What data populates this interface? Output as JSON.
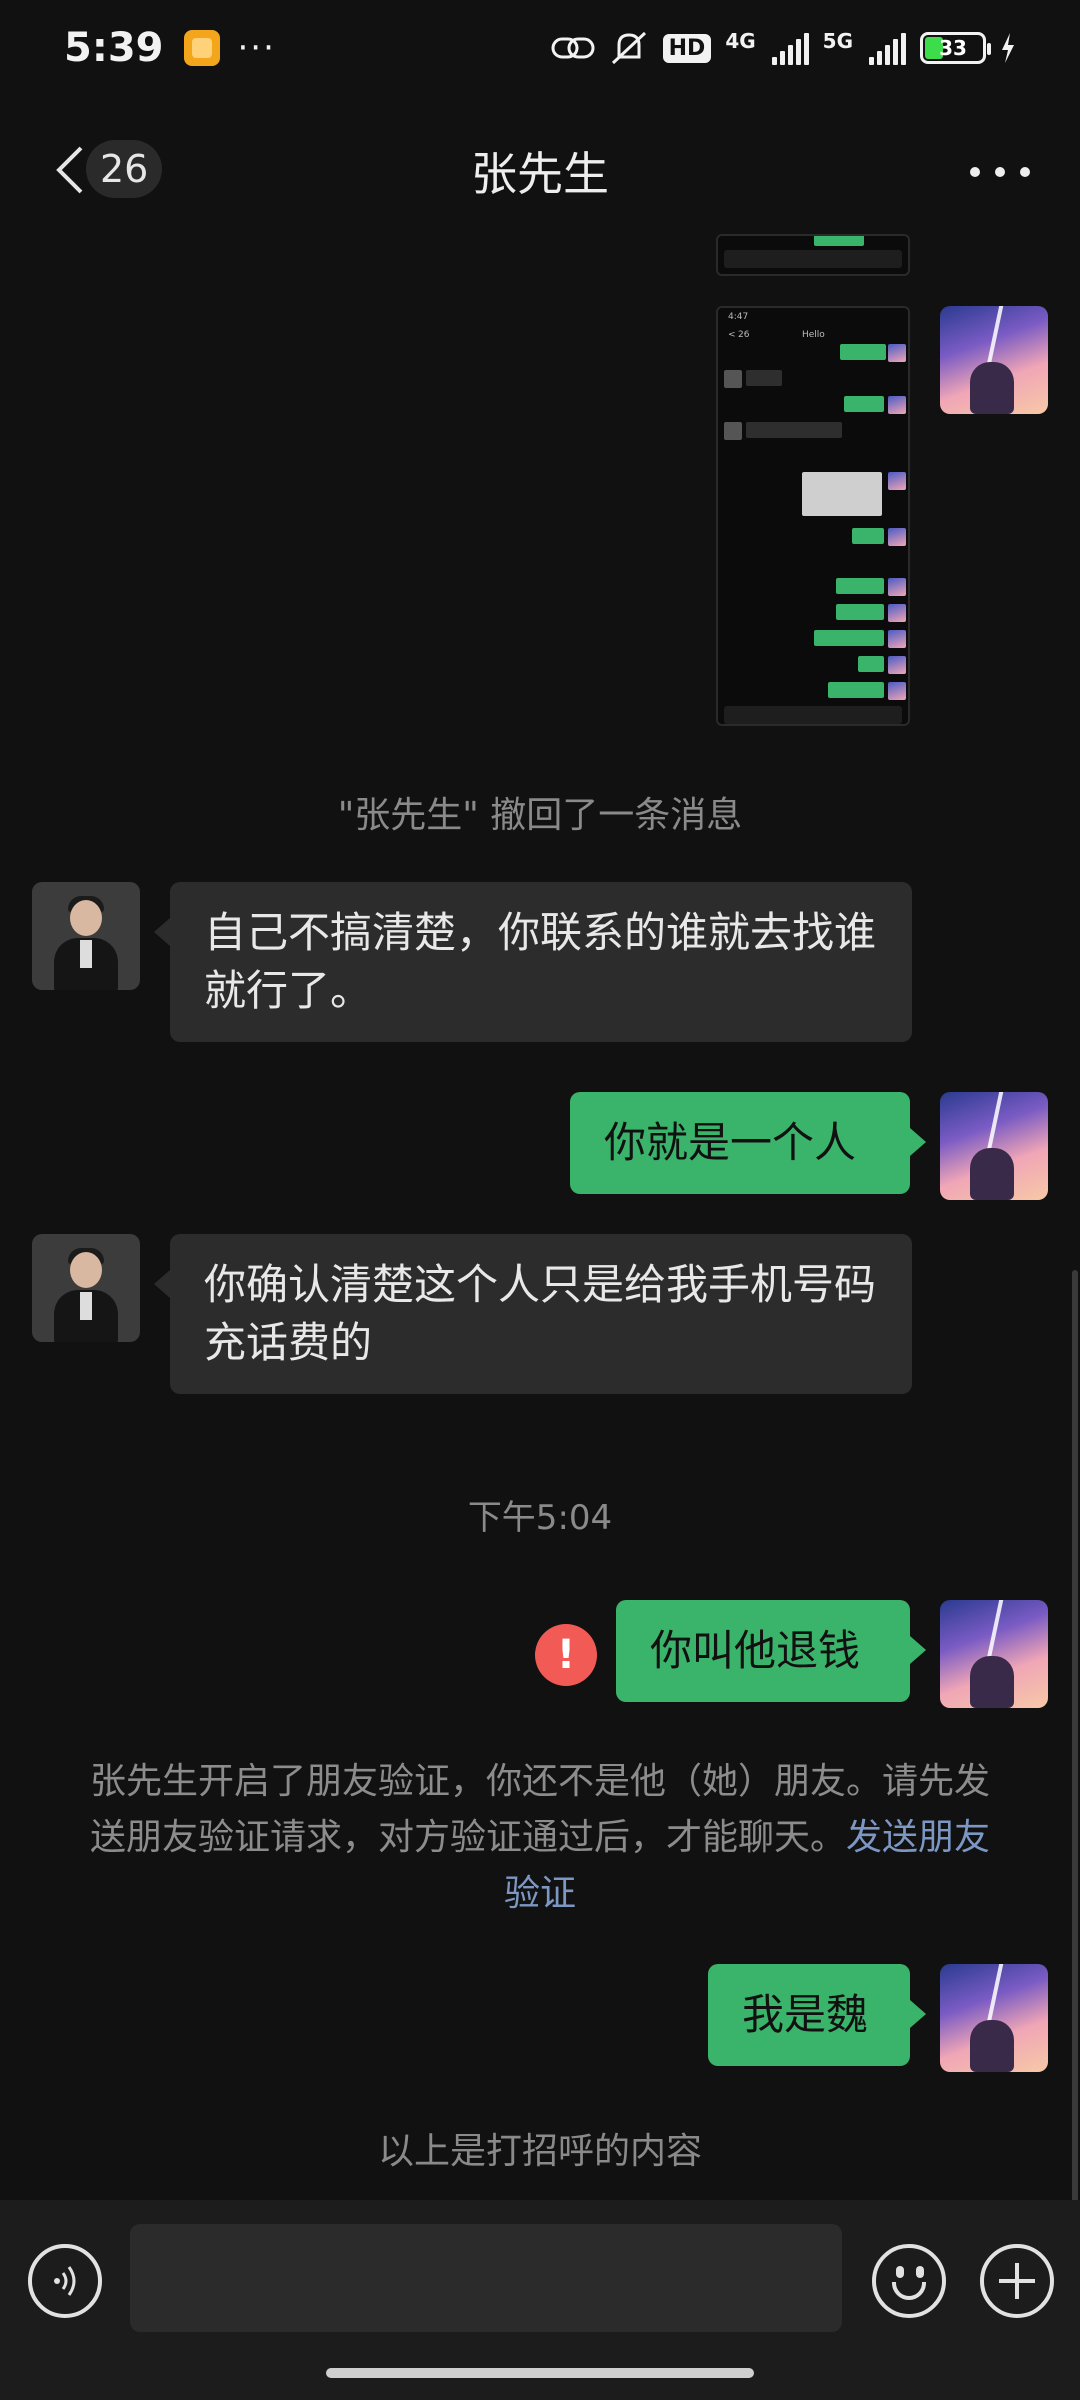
{
  "status_bar": {
    "time": "5:39",
    "more": "···",
    "hd": "HD",
    "net1": "4G",
    "net2": "5G",
    "battery": "33"
  },
  "header": {
    "unread_count": "26",
    "title": "张先生"
  },
  "screenshot": {
    "title": "Hello",
    "unread": "26"
  },
  "messages": {
    "recall_notice": "\"张先生\" 撤回了一条消息",
    "them_1": "自己不搞清楚，你联系的谁就去找谁就行了。",
    "me_1": "你就是一个人",
    "them_2": "你确认清楚这个人只是给我手机号码充话费的",
    "time_divider": "下午5:04",
    "me_2": "你叫他退钱",
    "error_mark": "!",
    "verify_notice": "张先生开启了朋友验证，你还不是他（她）朋友。请先发送朋友验证请求，对方验证通过后，才能聊天。",
    "verify_link": "发送朋友验证",
    "me_3": "我是魏",
    "greeting_notice": "以上是打招呼的内容"
  },
  "input": {
    "placeholder": ""
  },
  "colors": {
    "background": "#111111",
    "bubble_me": "#3bb46b",
    "bubble_them": "#2c2c2c",
    "link": "#7d97c4",
    "error": "#f25a55"
  }
}
